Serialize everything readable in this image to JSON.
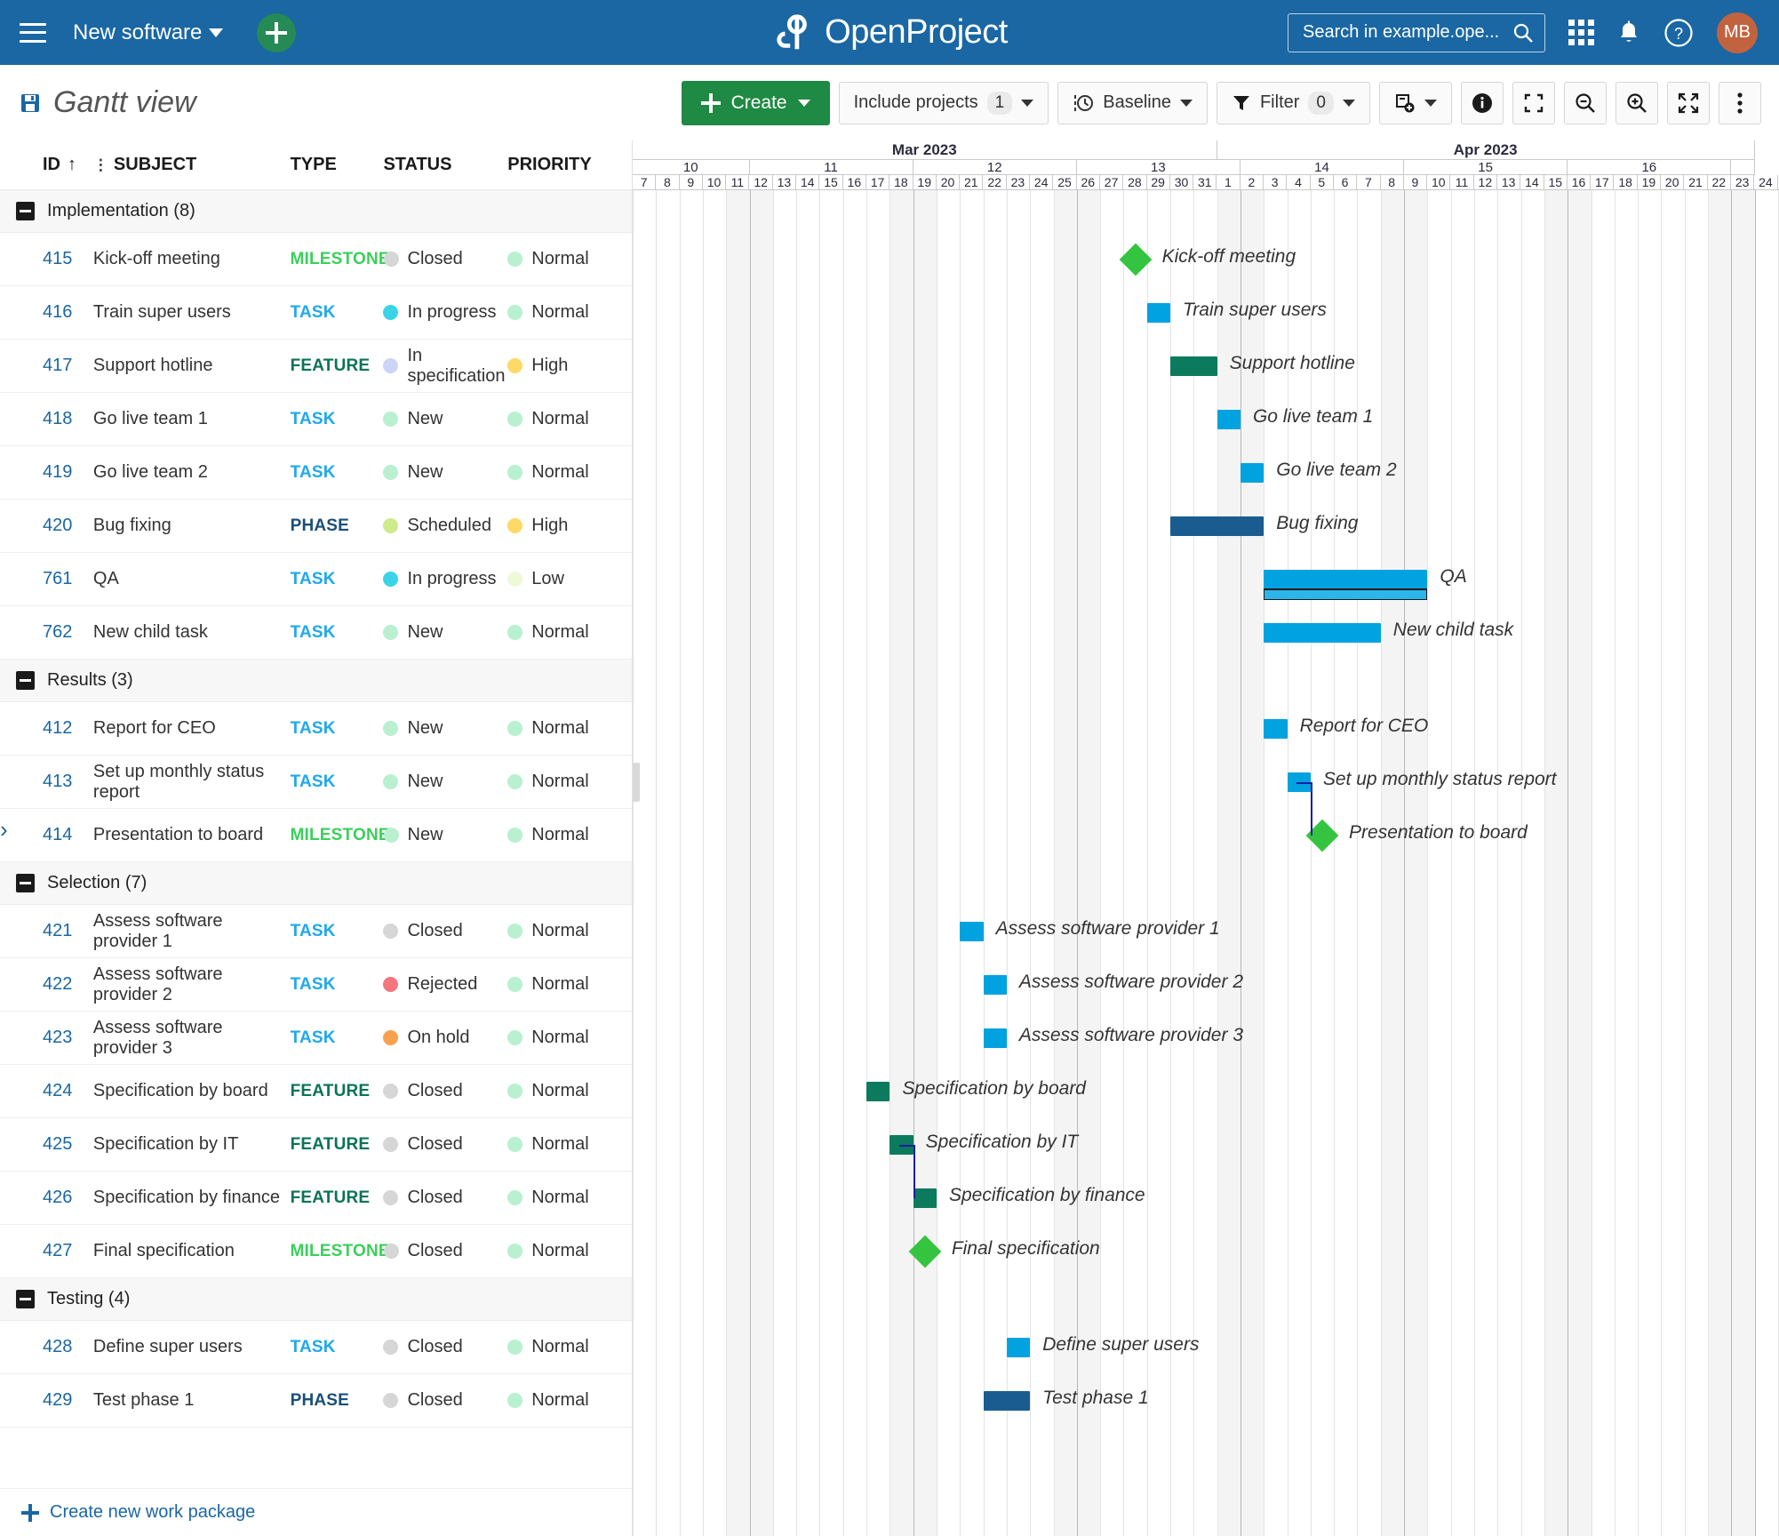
{
  "header": {
    "menu_icon": "hamburger-icon",
    "project_name": "New software",
    "add_icon": "plus-icon",
    "brand": "OpenProject",
    "search_placeholder": "Search in example.ope...",
    "search_icon": "search-icon",
    "modules_icon": "grid-modules-icon",
    "notifications_icon": "bell-icon",
    "help_icon": "help-circle-icon",
    "avatar_initials": "MB"
  },
  "toolbar": {
    "save_icon": "save-disk-icon",
    "title": "Gantt view",
    "create_label": "Create",
    "include_projects_label": "Include projects",
    "include_projects_count": "1",
    "baseline_label": "Baseline",
    "baseline_icon": "clock-baseline-icon",
    "filter_label": "Filter",
    "filter_count": "0",
    "filter_icon": "funnel-icon",
    "columns_icon": "insert-columns-icon",
    "info_icon": "info-icon",
    "zen_icon": "fullscreen-corners-icon",
    "zoom_out_icon": "zoom-out-icon",
    "zoom_in_icon": "zoom-in-icon",
    "expand_icon": "expand-arrows-icon",
    "more_icon": "kebab-menu-icon"
  },
  "table": {
    "columns": [
      "ID",
      "SUBJECT",
      "TYPE",
      "STATUS",
      "PRIORITY"
    ],
    "sort_indicator": "↑",
    "hierarchy_icon": "hierarchy-icon",
    "create_new_label": "Create new work package",
    "groups": [
      {
        "name": "Implementation (8)",
        "rows": [
          {
            "id": "415",
            "subject": "Kick-off meeting",
            "type": "MILESTONE",
            "status": "Closed",
            "status_color": "#d6d6d6",
            "priority": "Normal",
            "priority_color": "#b8f0d0"
          },
          {
            "id": "416",
            "subject": "Train super users",
            "type": "TASK",
            "status": "In progress",
            "status_color": "#3ad3e8",
            "priority": "Normal",
            "priority_color": "#b8f0d0"
          },
          {
            "id": "417",
            "subject": "Support hotline",
            "type": "FEATURE",
            "status": "In specification",
            "status_color": "#ccd4f7",
            "priority": "High",
            "priority_color": "#ffd966"
          },
          {
            "id": "418",
            "subject": "Go live team 1",
            "type": "TASK",
            "status": "New",
            "status_color": "#b8f0d0",
            "priority": "Normal",
            "priority_color": "#b8f0d0"
          },
          {
            "id": "419",
            "subject": "Go live team 2",
            "type": "TASK",
            "status": "New",
            "status_color": "#b8f0d0",
            "priority": "Normal",
            "priority_color": "#b8f0d0"
          },
          {
            "id": "420",
            "subject": "Bug fixing",
            "type": "PHASE",
            "status": "Scheduled",
            "status_color": "#cdeb8b",
            "priority": "High",
            "priority_color": "#ffd966"
          },
          {
            "id": "761",
            "subject": "QA",
            "type": "TASK",
            "status": "In progress",
            "status_color": "#3ad3e8",
            "priority": "Low",
            "priority_color": "#eef9d8"
          },
          {
            "id": "762",
            "subject": "New child task",
            "type": "TASK",
            "status": "New",
            "status_color": "#b8f0d0",
            "priority": "Normal",
            "priority_color": "#b8f0d0"
          }
        ]
      },
      {
        "name": "Results (3)",
        "rows": [
          {
            "id": "412",
            "subject": "Report for CEO",
            "type": "TASK",
            "status": "New",
            "status_color": "#b8f0d0",
            "priority": "Normal",
            "priority_color": "#b8f0d0"
          },
          {
            "id": "413",
            "subject": "Set up monthly status report",
            "type": "TASK",
            "status": "New",
            "status_color": "#b8f0d0",
            "priority": "Normal",
            "priority_color": "#b8f0d0"
          },
          {
            "id": "414",
            "subject": "Presentation to board",
            "type": "MILESTONE",
            "status": "New",
            "status_color": "#b8f0d0",
            "priority": "Normal",
            "priority_color": "#b8f0d0"
          }
        ]
      },
      {
        "name": "Selection (7)",
        "rows": [
          {
            "id": "421",
            "subject": "Assess software provider 1",
            "type": "TASK",
            "status": "Closed",
            "status_color": "#d6d6d6",
            "priority": "Normal",
            "priority_color": "#b8f0d0"
          },
          {
            "id": "422",
            "subject": "Assess software provider 2",
            "type": "TASK",
            "status": "Rejected",
            "status_color": "#f4777f",
            "priority": "Normal",
            "priority_color": "#b8f0d0"
          },
          {
            "id": "423",
            "subject": "Assess software provider 3",
            "type": "TASK",
            "status": "On hold",
            "status_color": "#f7a14e",
            "priority": "Normal",
            "priority_color": "#b8f0d0"
          },
          {
            "id": "424",
            "subject": "Specification by board",
            "type": "FEATURE",
            "status": "Closed",
            "status_color": "#d6d6d6",
            "priority": "Normal",
            "priority_color": "#b8f0d0"
          },
          {
            "id": "425",
            "subject": "Specification by IT",
            "type": "FEATURE",
            "status": "Closed",
            "status_color": "#d6d6d6",
            "priority": "Normal",
            "priority_color": "#b8f0d0"
          },
          {
            "id": "426",
            "subject": "Specification by finance",
            "type": "FEATURE",
            "status": "Closed",
            "status_color": "#d6d6d6",
            "priority": "Normal",
            "priority_color": "#b8f0d0"
          },
          {
            "id": "427",
            "subject": "Final specification",
            "type": "MILESTONE",
            "status": "Closed",
            "status_color": "#d6d6d6",
            "priority": "Normal",
            "priority_color": "#b8f0d0"
          }
        ]
      },
      {
        "name": "Testing (4)",
        "rows": [
          {
            "id": "428",
            "subject": "Define super users",
            "type": "TASK",
            "status": "Closed",
            "status_color": "#d6d6d6",
            "priority": "Normal",
            "priority_color": "#b8f0d0"
          },
          {
            "id": "429",
            "subject": "Test phase 1",
            "type": "PHASE",
            "status": "Closed",
            "status_color": "#d6d6d6",
            "priority": "Normal",
            "priority_color": "#b8f0d0"
          }
        ]
      }
    ]
  },
  "gantt": {
    "months": [
      {
        "label": "Mar 2023",
        "days": 25
      },
      {
        "label": "Apr 2023",
        "days": 23
      }
    ],
    "weeks": [
      {
        "label": "10",
        "days": 5
      },
      {
        "label": "11",
        "days": 7
      },
      {
        "label": "12",
        "days": 7
      },
      {
        "label": "13",
        "days": 7
      },
      {
        "label": "14",
        "days": 7
      },
      {
        "label": "15",
        "days": 7
      },
      {
        "label": "16",
        "days": 7
      },
      {
        "label": "",
        "days": 1
      }
    ],
    "day_labels": [
      "7",
      "8",
      "9",
      "10",
      "11",
      "12",
      "13",
      "14",
      "15",
      "16",
      "17",
      "18",
      "19",
      "20",
      "21",
      "22",
      "23",
      "24",
      "25",
      "26",
      "27",
      "28",
      "29",
      "30",
      "31",
      "1",
      "2",
      "3",
      "4",
      "5",
      "6",
      "7",
      "8",
      "9",
      "10",
      "11",
      "12",
      "13",
      "14",
      "15",
      "16",
      "17",
      "18",
      "19",
      "20",
      "21",
      "22",
      "23",
      "24"
    ],
    "weekend_indices": [
      4,
      5,
      11,
      12,
      18,
      19,
      25,
      26,
      32,
      33,
      39,
      40,
      46,
      47
    ],
    "colors": {
      "task": "#00A3E0",
      "feature": "#0C7A5C",
      "phase": "#1A5C8F",
      "milestone": "#35C43F",
      "relation": "#1B1BA8",
      "baseline_border": "#1a1a1a"
    },
    "bars": [
      {
        "label": "Kick-off meeting",
        "kind": "milestone",
        "start": 21,
        "span": 0,
        "row": 1
      },
      {
        "label": "Train super users",
        "kind": "task",
        "start": 22,
        "span": 1,
        "row": 2
      },
      {
        "label": "Support hotline",
        "kind": "feature",
        "start": 23,
        "span": 2,
        "row": 3
      },
      {
        "label": "Go live team 1",
        "kind": "task",
        "start": 25,
        "span": 1,
        "row": 4
      },
      {
        "label": "Go live team 2",
        "kind": "task",
        "start": 26,
        "span": 1,
        "row": 5
      },
      {
        "label": "Bug fixing",
        "kind": "phase",
        "start": 23,
        "span": 4,
        "row": 6
      },
      {
        "label": "QA",
        "kind": "task",
        "start": 27,
        "span": 7,
        "row": 7,
        "baseline": true
      },
      {
        "label": "New child task",
        "kind": "task",
        "start": 27,
        "span": 5,
        "row": 8
      },
      {
        "label": "Report for CEO",
        "kind": "task",
        "start": 27,
        "span": 1,
        "row": 10
      },
      {
        "label": "Set up monthly status report",
        "kind": "task",
        "start": 28,
        "span": 1,
        "row": 11
      },
      {
        "label": "Presentation to board",
        "kind": "milestone",
        "start": 29,
        "span": 0,
        "row": 12
      },
      {
        "label": "Assess software provider 1",
        "kind": "task",
        "start": 14,
        "span": 1,
        "row": 14
      },
      {
        "label": "Assess software provider 2",
        "kind": "task",
        "start": 15,
        "span": 1,
        "row": 15
      },
      {
        "label": "Assess software provider 3",
        "kind": "task",
        "start": 15,
        "span": 1,
        "row": 16
      },
      {
        "label": "Specification by board",
        "kind": "feature",
        "start": 10,
        "span": 1,
        "row": 17
      },
      {
        "label": "Specification by IT",
        "kind": "feature",
        "start": 11,
        "span": 1,
        "row": 18
      },
      {
        "label": "Specification by finance",
        "kind": "feature",
        "start": 12,
        "span": 1,
        "row": 19
      },
      {
        "label": "Final specification",
        "kind": "milestone",
        "start": 12,
        "span": 0,
        "row": 20
      },
      {
        "label": "Define super users",
        "kind": "task",
        "start": 16,
        "span": 1,
        "row": 22
      },
      {
        "label": "Test phase 1",
        "kind": "phase",
        "start": 15,
        "span": 2,
        "row": 23
      }
    ]
  }
}
